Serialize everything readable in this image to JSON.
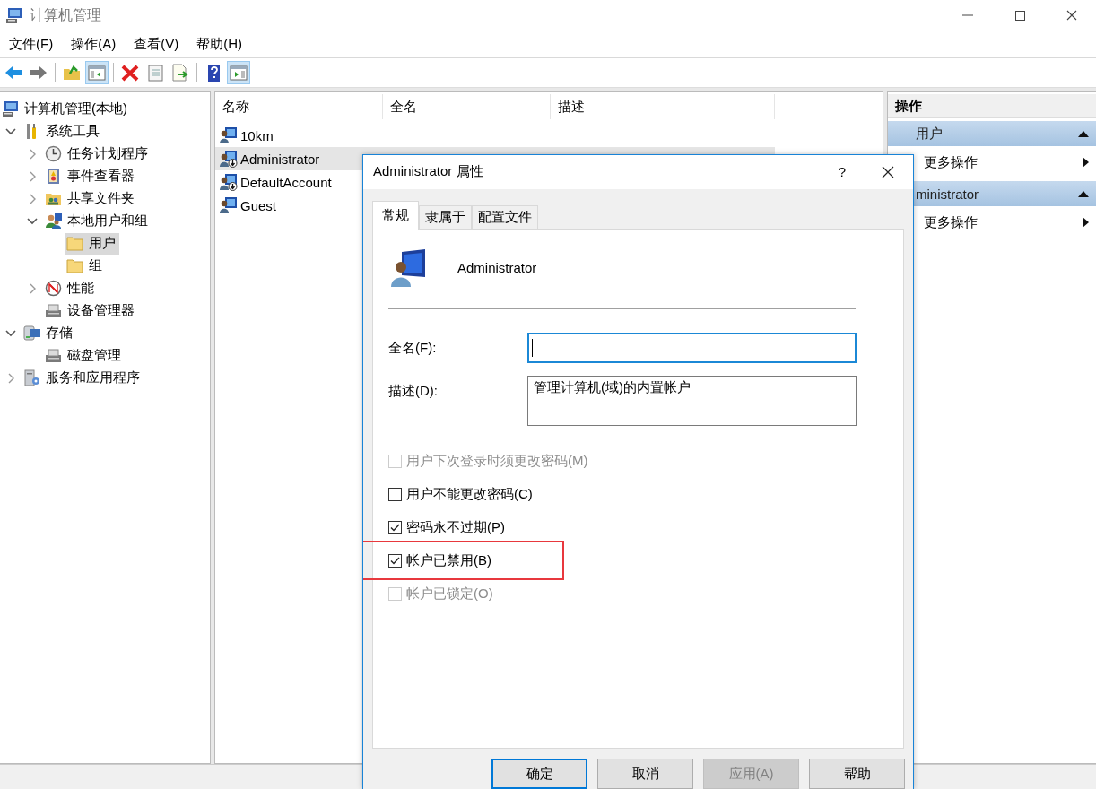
{
  "window": {
    "title": "计算机管理"
  },
  "menu": [
    "文件(F)",
    "操作(A)",
    "查看(V)",
    "帮助(H)"
  ],
  "toolbar": [
    {
      "kind": "back",
      "pressed": false
    },
    {
      "kind": "forward",
      "pressed": false
    },
    {
      "kind": "sep"
    },
    {
      "kind": "up",
      "pressed": false
    },
    {
      "kind": "tree",
      "pressed": true
    },
    {
      "kind": "sep"
    },
    {
      "kind": "delete",
      "pressed": false
    },
    {
      "kind": "properties",
      "pressed": false
    },
    {
      "kind": "export",
      "pressed": false
    },
    {
      "kind": "sep"
    },
    {
      "kind": "help",
      "pressed": false
    },
    {
      "kind": "actions",
      "pressed": true
    }
  ],
  "tree": {
    "label": "计算机管理(本地)",
    "kind": "computer",
    "selected": false,
    "children": [
      {
        "label": "系统工具",
        "kind": "tools",
        "expanded": true,
        "selected": false,
        "children": [
          {
            "label": "任务计划程序",
            "kind": "clock",
            "expanded": false,
            "selected": false
          },
          {
            "label": "事件查看器",
            "kind": "book",
            "expanded": false,
            "selected": false
          },
          {
            "label": "共享文件夹",
            "kind": "share",
            "expanded": false,
            "selected": false
          },
          {
            "label": "本地用户和组",
            "kind": "users",
            "expanded": true,
            "selected": false,
            "children": [
              {
                "label": "用户",
                "kind": "folder",
                "selected": true
              },
              {
                "label": "组",
                "kind": "folder",
                "selected": false
              }
            ]
          },
          {
            "label": "性能",
            "kind": "gauge",
            "expanded": false,
            "selected": false
          },
          {
            "label": "设备管理器",
            "kind": "device",
            "selected": false
          }
        ]
      },
      {
        "label": "存储",
        "kind": "storage",
        "expanded": true,
        "selected": false,
        "children": [
          {
            "label": "磁盘管理",
            "kind": "device",
            "selected": false
          }
        ]
      },
      {
        "label": "服务和应用程序",
        "kind": "services",
        "expanded": false,
        "selected": false
      }
    ]
  },
  "list": {
    "columns": [
      "名称",
      "全名",
      "描述"
    ],
    "rows": [
      {
        "name": "10km",
        "disabled": false,
        "selected": false
      },
      {
        "name": "Administrator",
        "disabled": true,
        "selected": true
      },
      {
        "name": "DefaultAccount",
        "disabled": true,
        "selected": false
      },
      {
        "name": "Guest",
        "disabled": false,
        "selected": false
      }
    ]
  },
  "actions": {
    "title": "操作",
    "sections": [
      {
        "title": "用户",
        "expanded": true,
        "items": [
          "更多操作"
        ]
      },
      {
        "title": "ministrator",
        "expanded": true,
        "items": [
          "更多操作"
        ]
      }
    ]
  },
  "dialog": {
    "title": "Administrator 属性",
    "help": "?",
    "tabs": [
      {
        "label": "常规",
        "selected": true
      },
      {
        "label": "隶属于",
        "selected": false
      },
      {
        "label": "配置文件",
        "selected": false
      }
    ],
    "user": "Administrator",
    "fields": [
      {
        "label": "全名(F):",
        "focused": true,
        "kind": "line"
      },
      {
        "label": "描述(D):",
        "value": "管理计算机(域)的内置帐户",
        "focused": false,
        "kind": "area"
      }
    ],
    "checkboxes": [
      {
        "label": "用户下次登录时须更改密码(M)",
        "checked": false,
        "disabled": true,
        "highlighted": false
      },
      {
        "label": "用户不能更改密码(C)",
        "checked": false,
        "disabled": false,
        "highlighted": false
      },
      {
        "label": "密码永不过期(P)",
        "checked": true,
        "disabled": false,
        "highlighted": false
      },
      {
        "label": "帐户已禁用(B)",
        "checked": true,
        "disabled": false,
        "highlighted": true
      },
      {
        "label": "帐户已锁定(O)",
        "checked": false,
        "disabled": true,
        "highlighted": false
      }
    ],
    "buttons": [
      {
        "label": "确定",
        "default": true,
        "disabled": false
      },
      {
        "label": "取消",
        "default": false,
        "disabled": false
      },
      {
        "label": "应用(A)",
        "default": false,
        "disabled": true
      },
      {
        "label": "帮助",
        "default": false,
        "disabled": false
      }
    ]
  }
}
